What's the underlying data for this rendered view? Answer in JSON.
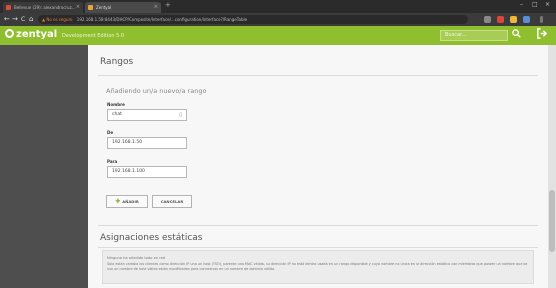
{
  "browser": {
    "tabs": [
      {
        "label": "Bellevue (29): alexandrocruz...",
        "close": "×"
      },
      {
        "label": "Zentyal",
        "close": "×"
      }
    ],
    "new_tab": "+",
    "window_controls": {
      "minimize": "–",
      "maximize": "□",
      "close": "×"
    },
    "url_security": "▲ No es seguro",
    "url": "192.168.1.58:8443/DHCP/Composite/Interface/...configuration/Interface?/RangeTable",
    "nav": {
      "back": "←",
      "forward": "→",
      "reload": "C",
      "home": "⌂"
    }
  },
  "header": {
    "logo": "zentyal",
    "edition": "Development Edition  5.0",
    "search_placeholder": "Buscar...",
    "search_icon": "search-icon",
    "logout_icon": "logout-icon"
  },
  "page": {
    "title": "Rangos",
    "subtitle": "Añadiendo un/a nuevo/a rango",
    "form": {
      "name_label": "Nombre",
      "name_value": "chat",
      "from_label": "De",
      "from_value": "192.168.1.50",
      "to_label": "Para",
      "to_value": "192.168.1.100"
    },
    "add_button": "AÑADIR",
    "cancel_button": "CANCELAR",
    "static_title": "Asignaciones estáticas",
    "static_info_title": "Ninguna ha añadido todo en red",
    "static_info_text": "Solo están cambio los clientes como dirección IP una un host (TSO), parente una MAC válida, su dirección IP no está dentro usada en un rango disponible y cuyo nombre no única en la dirección estática con miembros que poseer un nombre que se usa un nombre de host válido están modificados para concesivos en un nombre de dominio válido."
  }
}
